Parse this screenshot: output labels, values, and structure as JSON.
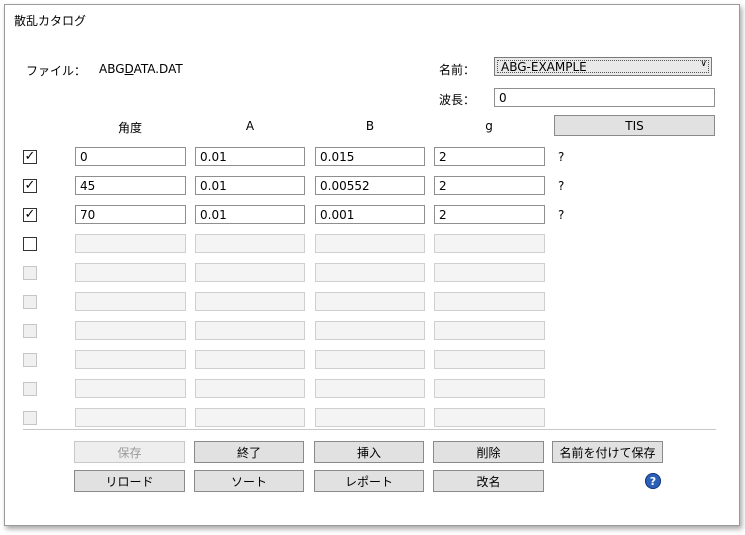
{
  "window": {
    "title": "散乱カタログ"
  },
  "file": {
    "label": "ファイル：",
    "value_prefix": "ABG",
    "value_mnemonic": "D",
    "value_suffix": "ATA.DAT"
  },
  "name": {
    "label": "名前：",
    "selected": "ABG-EXAMPLE"
  },
  "wavelength": {
    "label": "波長：",
    "value": "0"
  },
  "tis_button": "TIS",
  "table": {
    "headers": [
      "角度",
      "A",
      "B",
      "g"
    ],
    "rows": [
      {
        "checked": true,
        "enabled": true,
        "cells": [
          "0",
          "0.01",
          "0.015",
          "2"
        ],
        "status": "?"
      },
      {
        "checked": true,
        "enabled": true,
        "cells": [
          "45",
          "0.01",
          "0.00552",
          "2"
        ],
        "status": "?"
      },
      {
        "checked": true,
        "enabled": true,
        "cells": [
          "70",
          "0.01",
          "0.001",
          "2"
        ],
        "status": "?"
      },
      {
        "checked": false,
        "enabled": true,
        "cells": [
          "",
          "",
          "",
          ""
        ],
        "status": ""
      },
      {
        "checked": false,
        "enabled": false,
        "cells": [
          "",
          "",
          "",
          ""
        ],
        "status": ""
      },
      {
        "checked": false,
        "enabled": false,
        "cells": [
          "",
          "",
          "",
          ""
        ],
        "status": ""
      },
      {
        "checked": false,
        "enabled": false,
        "cells": [
          "",
          "",
          "",
          ""
        ],
        "status": ""
      },
      {
        "checked": false,
        "enabled": false,
        "cells": [
          "",
          "",
          "",
          ""
        ],
        "status": ""
      },
      {
        "checked": false,
        "enabled": false,
        "cells": [
          "",
          "",
          "",
          ""
        ],
        "status": ""
      },
      {
        "checked": false,
        "enabled": false,
        "cells": [
          "",
          "",
          "",
          ""
        ],
        "status": ""
      }
    ]
  },
  "buttons": {
    "save": "保存",
    "exit": "終了",
    "insert": "挿入",
    "delete": "削除",
    "save_as": "名前を付けて保存",
    "reload": "リロード",
    "sort": "ソート",
    "report": "レポート",
    "rename": "改名"
  },
  "colors": {
    "help_icon": "#2b5fb8",
    "button_face": "#e1e1e1"
  }
}
